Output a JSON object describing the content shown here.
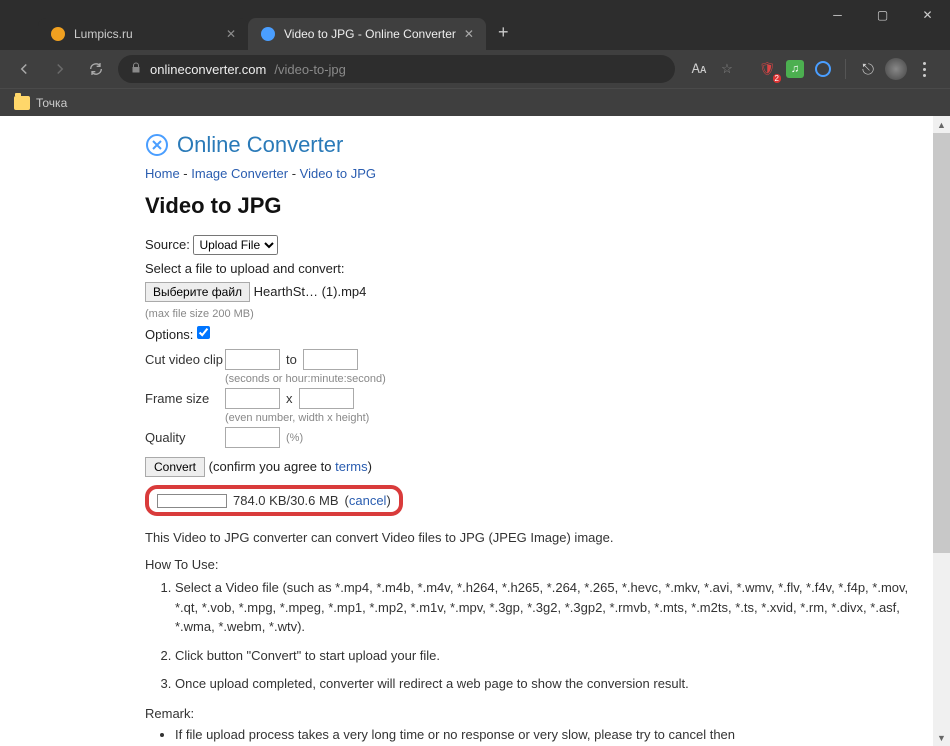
{
  "window": {
    "tab1": {
      "title": "Lumpics.ru"
    },
    "tab2": {
      "title": "Video to JPG - Online Converter"
    }
  },
  "address": {
    "host": "onlineconverter.com",
    "path": "/video-to-jpg"
  },
  "extensions": {
    "badge": "2"
  },
  "bookmarks": {
    "folder1": "Точка"
  },
  "brand": {
    "name": "Online Converter"
  },
  "crumbs": {
    "home": "Home",
    "sep": " - ",
    "image": "Image Converter",
    "leaf": "Video to JPG"
  },
  "h1": "Video to JPG",
  "form": {
    "source_label": "Source:",
    "source_value": "Upload File",
    "select_label": "Select a file to upload and convert:",
    "choose_btn": "Выберите файл",
    "filename": "HearthSt… (1).mp4",
    "max_hint": "(max file size 200 MB)",
    "options_label": "Options:",
    "cut_label": "Cut video clip",
    "to": "to",
    "cut_hint": "(seconds or hour:minute:second)",
    "frame_label": "Frame size",
    "x": "x",
    "frame_hint": "(even number, width x height)",
    "quality_label": "Quality",
    "quality_hint": "(%)",
    "convert_btn": "Convert",
    "agree1": "(confirm you agree to ",
    "terms": "terms",
    "agree2": ")",
    "progress_text": "784.0 KB/30.6 MB",
    "cancel": "cancel"
  },
  "desc": "This Video to JPG converter can convert Video files to JPG (JPEG Image) image.",
  "howto_title": "How To Use:",
  "howto": [
    "Select a Video file (such as *.mp4, *.m4b, *.m4v, *.h264, *.h265, *.264, *.265, *.hevc, *.mkv, *.avi, *.wmv, *.flv, *.f4v, *.f4p, *.mov, *.qt, *.vob, *.mpg, *.mpeg, *.mp1, *.mp2, *.m1v, *.mpv, *.3gp, *.3g2, *.3gp2, *.rmvb, *.mts, *.m2ts, *.ts, *.xvid, *.rm, *.divx, *.asf, *.wma, *.webm, *.wtv).",
    "Click button \"Convert\" to start upload your file.",
    "Once upload completed, converter will redirect a web page to show the conversion result."
  ],
  "remark_title": "Remark:",
  "remark": [
    "If file upload process takes a very long time or no response or very slow, please try to cancel then"
  ]
}
